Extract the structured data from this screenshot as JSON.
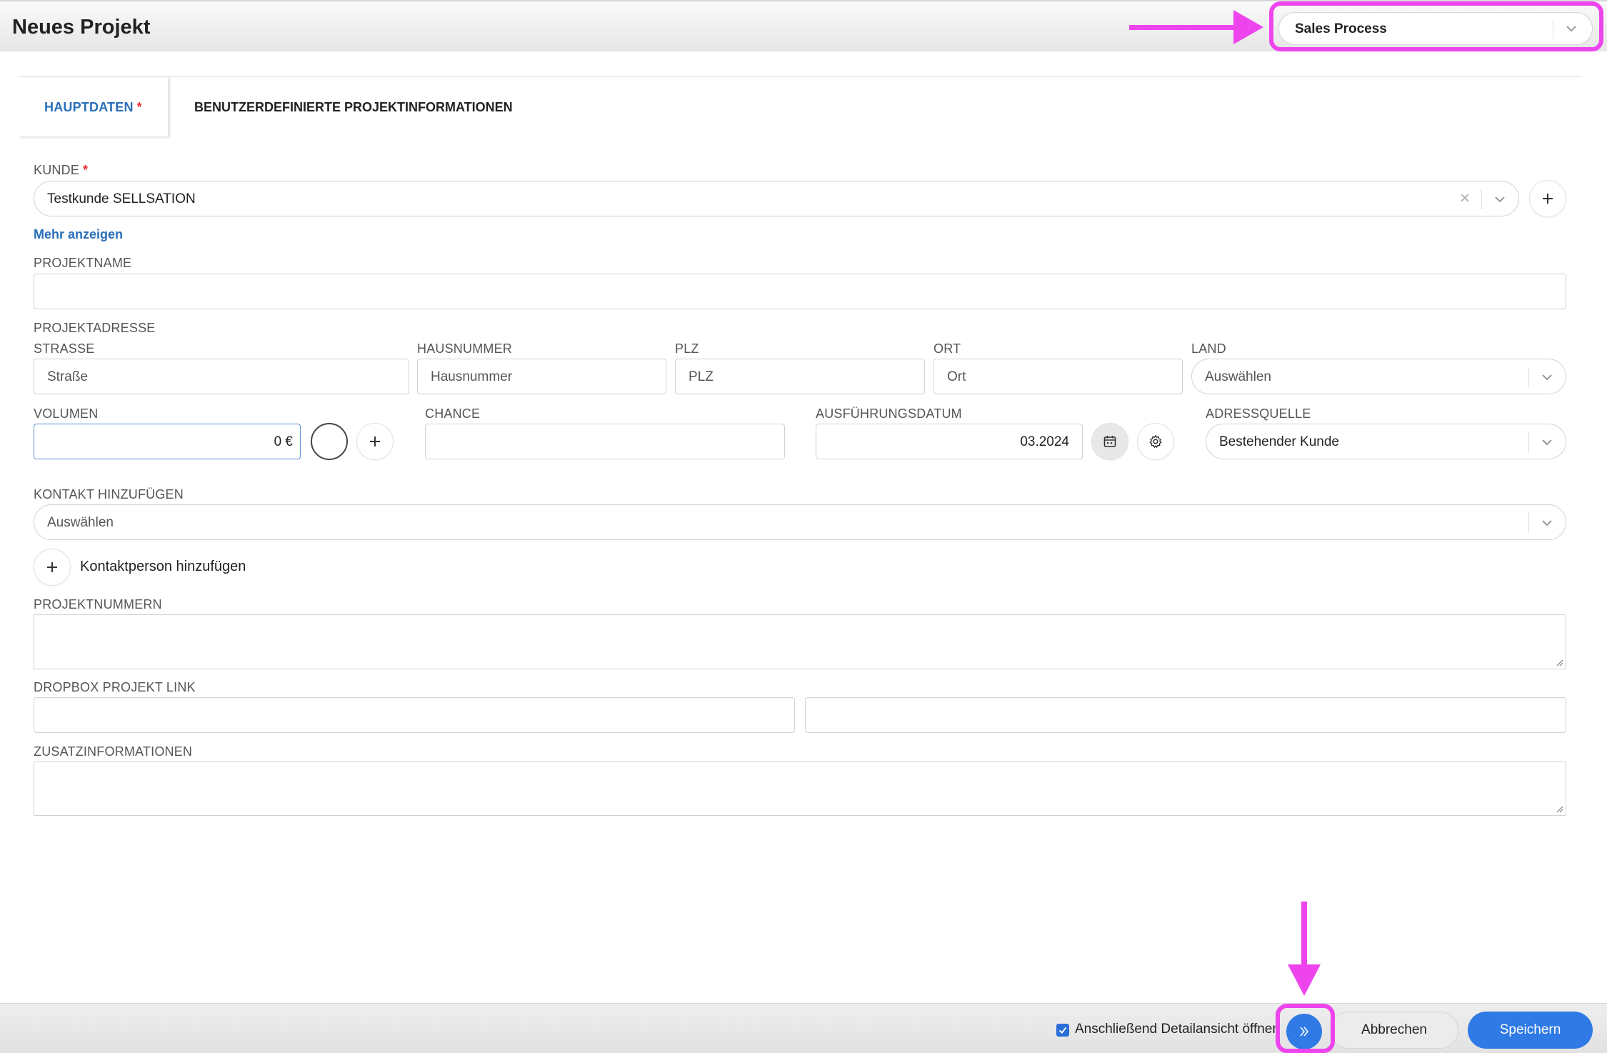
{
  "header": {
    "title": "Neues Projekt",
    "process_select_value": "Sales Process"
  },
  "tabs": [
    {
      "label": "HAUPTDATEN",
      "required_mark": "*"
    },
    {
      "label": "BENUTZERDEFINIERTE PROJEKTINFORMATIONEN"
    }
  ],
  "form": {
    "kunde": {
      "label": "KUNDE",
      "required_mark": "*",
      "value": "Testkunde SELLSATION",
      "clear_glyph": "×"
    },
    "more_link": "Mehr anzeigen",
    "projektname": {
      "label": "PROJEKTNAME",
      "value": ""
    },
    "projektadresse": {
      "label": "PROJEKTADRESSE",
      "strasse": {
        "label": "STRASSE",
        "placeholder": "Straße"
      },
      "hausnummer": {
        "label": "HAUSNUMMER",
        "placeholder": "Hausnummer"
      },
      "plz": {
        "label": "PLZ",
        "placeholder": "PLZ"
      },
      "ort": {
        "label": "ORT",
        "placeholder": "Ort"
      },
      "land": {
        "label": "LAND",
        "placeholder": "Auswählen"
      }
    },
    "volumen": {
      "label": "VOLUMEN",
      "value": "0 €"
    },
    "chance": {
      "label": "CHANCE",
      "value": ""
    },
    "ausfuehrungsdatum": {
      "label": "AUSFÜHRUNGSDATUM",
      "value": "03.2024"
    },
    "adressquelle": {
      "label": "ADRESSQUELLE",
      "value": "Bestehender Kunde"
    },
    "kontakt": {
      "label": "KONTAKT HINZUFÜGEN",
      "placeholder": "Auswählen"
    },
    "kontaktperson_button": "Kontaktperson hinzufügen",
    "projektnummern": {
      "label": "PROJEKTNUMMERN",
      "value": ""
    },
    "dropbox": {
      "label": "DROPBOX PROJEKT LINK",
      "value_1": "",
      "value_2": ""
    },
    "zusatzinformationen": {
      "label": "ZUSATZINFORMATIONEN",
      "value": ""
    }
  },
  "footer": {
    "open_detail_checkbox_label": "Anschließend Detailansicht öffnen",
    "open_detail_checked": true,
    "cancel_label": "Abbrechen",
    "save_label": "Speichern"
  },
  "colors": {
    "accent": "#2f7ae5",
    "link": "#2a6eb8",
    "required": "#e0302a",
    "annotation": "#ee44ee"
  },
  "icons": [
    "chevron-down-icon",
    "clear-icon",
    "plus-icon",
    "calendar-icon",
    "gear-icon",
    "double-chevron-right-icon",
    "checkmark-icon"
  ]
}
